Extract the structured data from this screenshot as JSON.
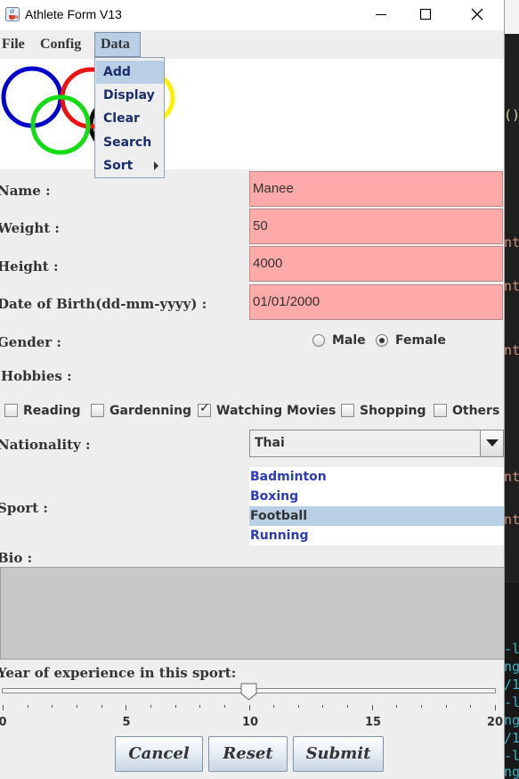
{
  "window": {
    "title": "Athlete Form V13"
  },
  "menubar": {
    "file": "File",
    "config": "Config",
    "data": "Data"
  },
  "data_menu": {
    "items": [
      "Add",
      "Display",
      "Clear",
      "Search",
      "Sort"
    ],
    "selected": "Add"
  },
  "form": {
    "name_label": "Name :",
    "name_value": "Manee",
    "weight_label": "Weight :",
    "weight_value": "50",
    "height_label": "Height :",
    "height_value": "4000",
    "dob_label": "Date of Birth(dd-mm-yyyy) :",
    "dob_value": "01/01/2000",
    "gender_label": "Gender :",
    "gender_options": [
      "Male",
      "Female"
    ],
    "gender_selected": "Female",
    "hobbies_label": "Hobbies :",
    "hobbies": [
      {
        "label": "Reading",
        "checked": false
      },
      {
        "label": "Gardenning",
        "checked": false
      },
      {
        "label": "Watching Movies",
        "checked": true
      },
      {
        "label": "Shopping",
        "checked": false
      },
      {
        "label": "Others",
        "checked": false
      }
    ],
    "nationality_label": "Nationality :",
    "nationality_value": "Thai",
    "sport_label": "Sport :",
    "sports": [
      "Badminton",
      "Boxing",
      "Football",
      "Running"
    ],
    "sport_selected": "Football",
    "bio_label": "Bio :",
    "bio_value": "",
    "experience_label": "Year of experience in this sport:",
    "experience_value": 10,
    "experience_min": 0,
    "experience_max": 20,
    "experience_tick_labels": [
      "0",
      "5",
      "10",
      "15",
      "20"
    ]
  },
  "buttons": {
    "cancel": "Cancel",
    "reset": "Reset",
    "submit": "Submit"
  },
  "colors": {
    "field_bg": "#ffaaaa",
    "menu_highlight": "#b8cfe5",
    "list_text": "#2a3db5",
    "ring_blue": "#0000cc",
    "ring_red": "#ee1111",
    "ring_yellow": "#ffee00",
    "ring_green": "#11dd11",
    "ring_black": "#000000"
  },
  "background_editor": {
    "fragments": [
      "()",
      "nt",
      "nt",
      "nt",
      "nt",
      "nt",
      "-la",
      "ng",
      "/1",
      "-la",
      "ng",
      "/1",
      "-la",
      "ng"
    ]
  }
}
